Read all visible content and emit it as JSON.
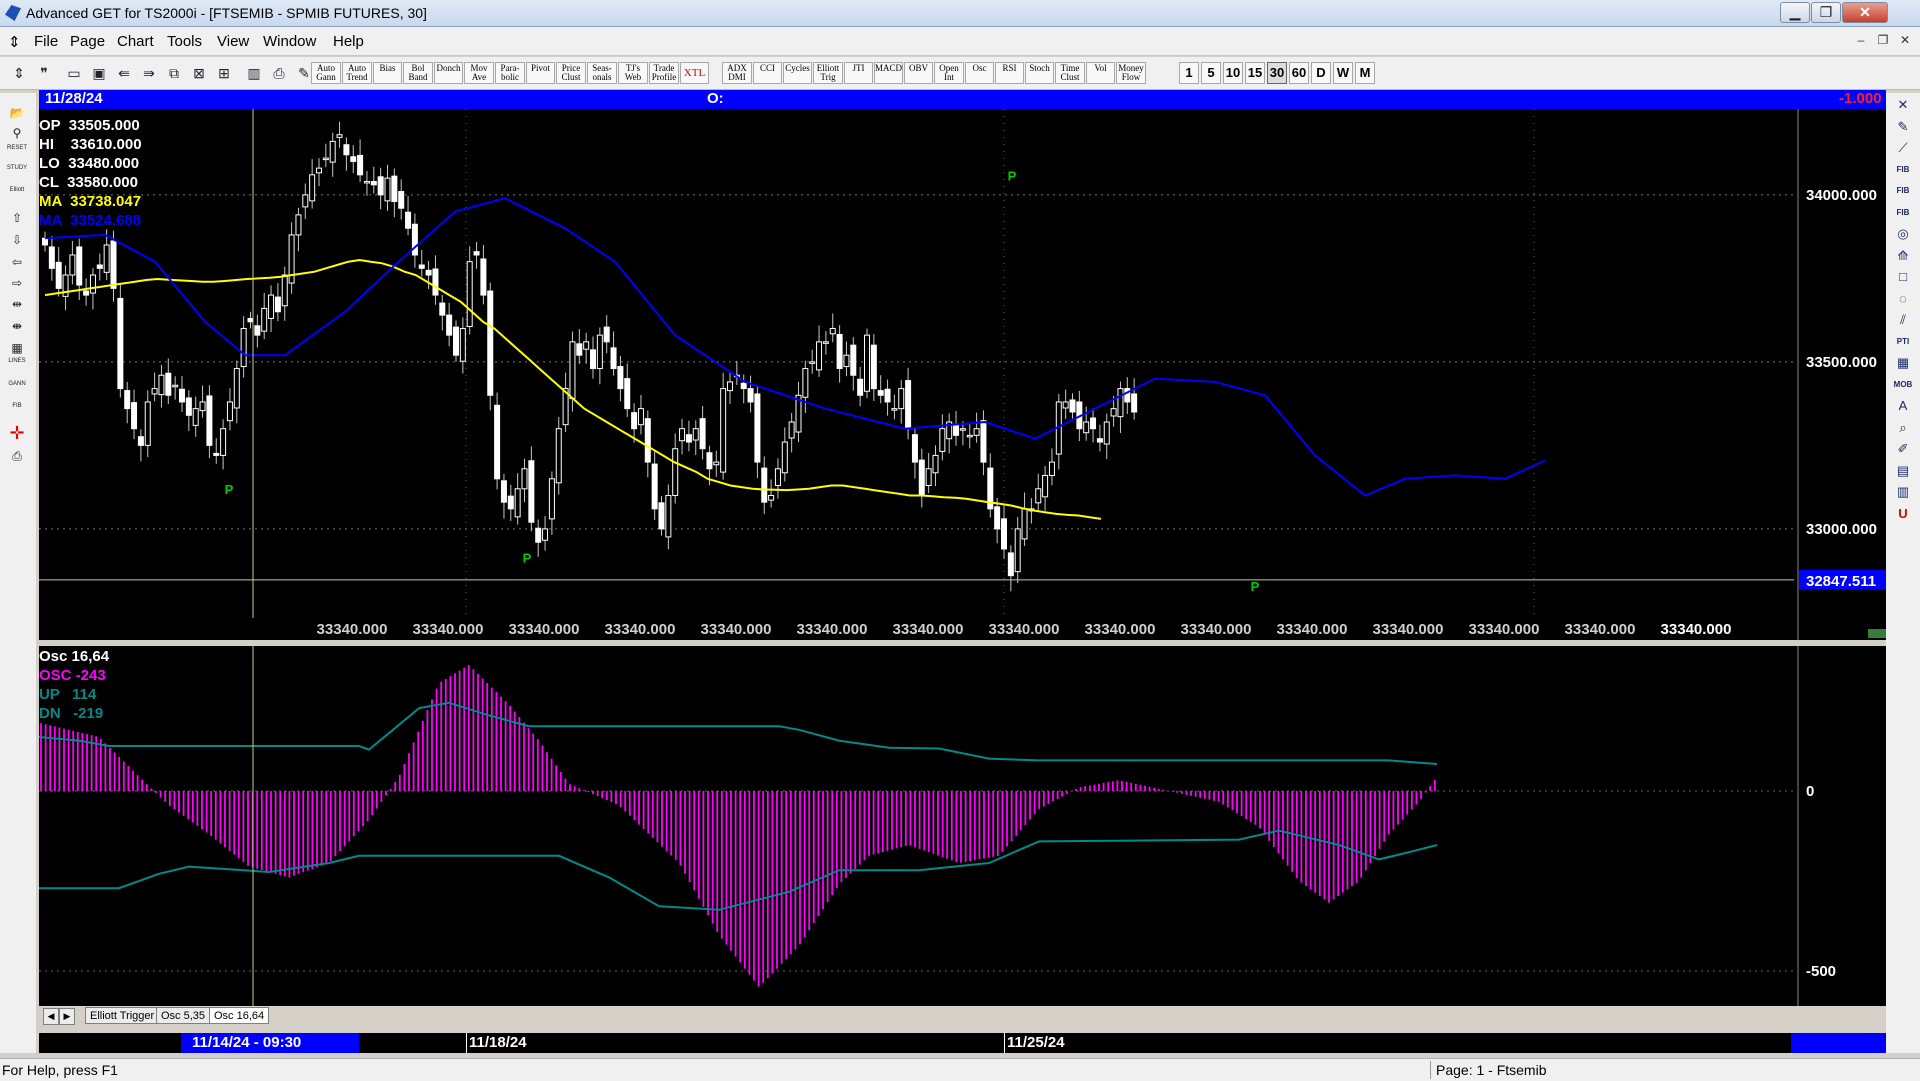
{
  "window": {
    "title": "Advanced GET for TS2000i - [FTSEMIB - SPMIB FUTURES, 30]",
    "minimize": "▁",
    "restore": "❐",
    "close": "✕"
  },
  "menu": [
    "File",
    "Page",
    "Chart",
    "Tools",
    "View",
    "Window",
    "Help"
  ],
  "mdi": {
    "minimize": "‒",
    "restore": "❐",
    "close": "✕"
  },
  "toolbar": {
    "studies": [
      "Auto Gann",
      "Auto Trend",
      "Bias",
      "Bol Band",
      "Donch",
      "Mov Ave",
      "Para-bolic",
      "Pivot",
      "Price Clust",
      "Seas-onals",
      "TJ's Web",
      "Trade Profile",
      "XTL",
      "ADX DMI",
      "CCI",
      "Cycles",
      "Elliott Trig",
      "JTI",
      "MACD",
      "OBV",
      "Open Int",
      "Osc",
      "RSI",
      "Stoch",
      "Time Clust",
      "Vol",
      "Money Flow"
    ],
    "intervals": [
      "1",
      "5",
      "10",
      "15",
      "30",
      "60",
      "D",
      "W",
      "M"
    ],
    "selected_interval": "30"
  },
  "chart_header": {
    "date": "11/28/24",
    "open_label": "O:",
    "value": "-1.000"
  },
  "price_info": {
    "op": {
      "label": "OP",
      "value": "33505.000"
    },
    "hi": {
      "label": "HI",
      "value": "33610.000"
    },
    "lo": {
      "label": "LO",
      "value": "33480.000"
    },
    "cl": {
      "label": "CL",
      "value": "33580.000"
    },
    "ma1": {
      "label": "MA",
      "value": "33738.047",
      "color": "#ffff00"
    },
    "ma2": {
      "label": "MA",
      "value": "33524.688",
      "color": "#0000ff"
    }
  },
  "price_axis": {
    "ticks": [
      "34000.000",
      "33500.000",
      "33000.000"
    ],
    "cursor_value": "32847.511"
  },
  "price_xlabels": [
    "33340.000",
    "33340.000",
    "33340.000",
    "33340.000",
    "33340.000",
    "33340.000",
    "33340.000",
    "33340.000",
    "33340.000",
    "33340.000",
    "33340.000",
    "33340.000",
    "33340.000",
    "33340.000",
    "33340.000"
  ],
  "pivot_label": "P",
  "osc_info": {
    "title": "Osc 16,64",
    "osc": {
      "label": "OSC",
      "value": "-243",
      "color": "#ff00ff"
    },
    "up": {
      "label": "UP",
      "value": "114",
      "color": "#008b8b"
    },
    "dn": {
      "label": "DN",
      "value": "-219",
      "color": "#008b8b"
    }
  },
  "osc_axis": {
    "ticks": [
      "0",
      "-500"
    ]
  },
  "tabs": [
    "Elliott Trigger",
    "Osc 5,35",
    "Osc 16,64"
  ],
  "active_tab": "Osc 16,64",
  "dates": {
    "cursor": "11/14/24 - 09:30",
    "d1": "11/18/24",
    "d2": "11/25/24"
  },
  "status": {
    "help": "For Help, press F1",
    "page": "Page: 1 - Ftsemib"
  },
  "chart_data": {
    "type": "candlestick",
    "y_range": [
      32760,
      34220
    ],
    "ticks": [
      34000,
      33500,
      33000
    ],
    "cursor_level": 32847.511,
    "close": [
      33850,
      33780,
      33720,
      33760,
      33820,
      33730,
      33700,
      33760,
      33780,
      33850,
      33720,
      33420,
      33360,
      33300,
      33250,
      33380,
      33420,
      33460,
      33400,
      33430,
      33380,
      33340,
      33360,
      33380,
      33250,
      33220,
      33300,
      33380,
      33480,
      33600,
      33620,
      33580,
      33660,
      33700,
      33650,
      33760,
      33880,
      33940,
      34000,
      34060,
      34080,
      34110,
      34160,
      34180,
      34120,
      34100,
      34060,
      34040,
      34030,
      34000,
      34050,
      33980,
      33960,
      33900,
      33820,
      33780,
      33760,
      33700,
      33640,
      33580,
      33520,
      33600,
      33800,
      33820,
      33700,
      33400,
      33150,
      33080,
      33060,
      33120,
      33180,
      33020,
      32960,
      33000,
      33150,
      33300,
      33420,
      33560,
      33520,
      33560,
      33480,
      33580,
      33560,
      33480,
      33420,
      33360,
      33300,
      33360,
      33200,
      33060,
      33000,
      33100,
      33240,
      33300,
      33260,
      33300,
      33240,
      33180,
      33200,
      33420,
      33440,
      33460,
      33420,
      33380,
      33200,
      33080,
      33100,
      33180,
      33260,
      33320,
      33400,
      33480,
      33500,
      33560,
      33560,
      33600,
      33480,
      33520,
      33460,
      33400,
      33580,
      33420,
      33400,
      33380,
      33360,
      33420,
      33300,
      33200,
      33100,
      33180,
      33220,
      33300,
      33320,
      33280,
      33300,
      33280,
      33300,
      33200,
      33060,
      33000,
      32940,
      32860,
      33000,
      33060,
      33060,
      33120,
      33160,
      33200,
      33380,
      33380,
      33350,
      33300,
      33320,
      33300,
      33260,
      33320,
      33360,
      33420,
      33380,
      33350
    ],
    "pivots": [
      {
        "index": 41,
        "type": "high",
        "value": 34200
      },
      {
        "index": 24,
        "type": "low",
        "value": 33230
      },
      {
        "index": 88,
        "type": "low",
        "value": 32930
      },
      {
        "index": 110,
        "type": "high",
        "value": 33760
      },
      {
        "index": 138,
        "type": "low",
        "value": 32850
      }
    ],
    "ma_yellow": [
      33700,
      33705,
      33710,
      33715,
      33720,
      33725,
      33730,
      33735,
      33740,
      33745,
      33748,
      33746,
      33744,
      33742,
      33740,
      33740,
      33742,
      33745,
      33748,
      33750,
      33752,
      33755,
      33760,
      33765,
      33770,
      33780,
      33790,
      33800,
      33805,
      33800,
      33795,
      33785,
      33770,
      33760,
      33740,
      33720,
      33700,
      33680,
      33650,
      33620,
      33600,
      33570,
      33540,
      33510,
      33480,
      33450,
      33420,
      33390,
      33360,
      33340,
      33320,
      33300,
      33280,
      33260,
      33240,
      33220,
      33200,
      33185,
      33170,
      33150,
      33140,
      33130,
      33125,
      33120,
      33118,
      33117,
      33116,
      33118,
      33120,
      33125,
      33130,
      33130,
      33125,
      33120,
      33115,
      33110,
      33105,
      33100,
      33100,
      33098,
      33095,
      33093,
      33090,
      33085,
      33080,
      33075,
      33070,
      33062,
      33055,
      33050,
      33045,
      33042,
      33040,
      33035,
      33030
    ],
    "ma_blue_ranges": "see script",
    "osc": {
      "y_range": [
        -560,
        360
      ],
      "ticks": [
        0,
        -500
      ],
      "up_level": 114,
      "dn_level": -219
    }
  }
}
